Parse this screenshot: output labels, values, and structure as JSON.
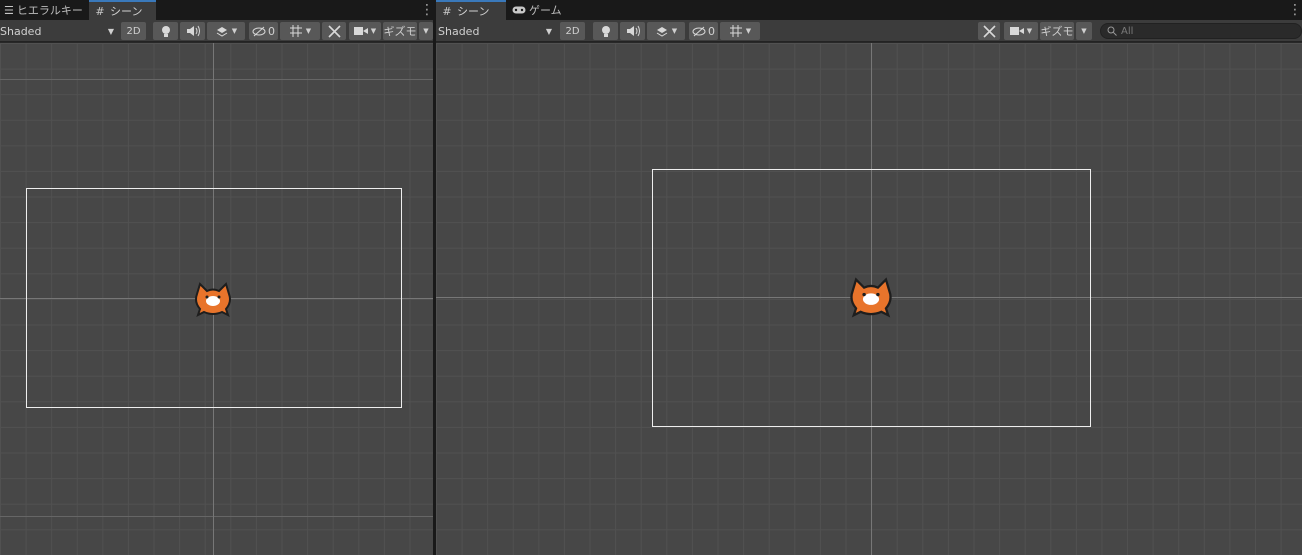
{
  "left_panel": {
    "tabs": [
      {
        "label": "ヒエラルキー",
        "icon": "hierarchy-list-icon",
        "active": false
      },
      {
        "label": "シーン",
        "icon": "scene-grid-icon",
        "active": true
      }
    ],
    "toolbar": {
      "shading_mode": "Shaded",
      "mode_2d_label": "2D",
      "hidden_count": "0",
      "gizmos_label": "ギズモ"
    }
  },
  "right_panel": {
    "tabs": [
      {
        "label": "シーン",
        "icon": "scene-grid-icon",
        "active": true
      },
      {
        "label": "ゲーム",
        "icon": "gamepad-icon",
        "active": false
      }
    ],
    "toolbar": {
      "shading_mode": "Shaded",
      "mode_2d_label": "2D",
      "hidden_count": "0",
      "gizmos_label": "ギズモ",
      "search_placeholder": "All"
    }
  },
  "colors": {
    "tab_accent": "#3a79bb",
    "scene_background": "#474747",
    "grid_line": "#515151",
    "camera_frame": "#eeeeee",
    "sprite_fur": "#e8742b"
  }
}
